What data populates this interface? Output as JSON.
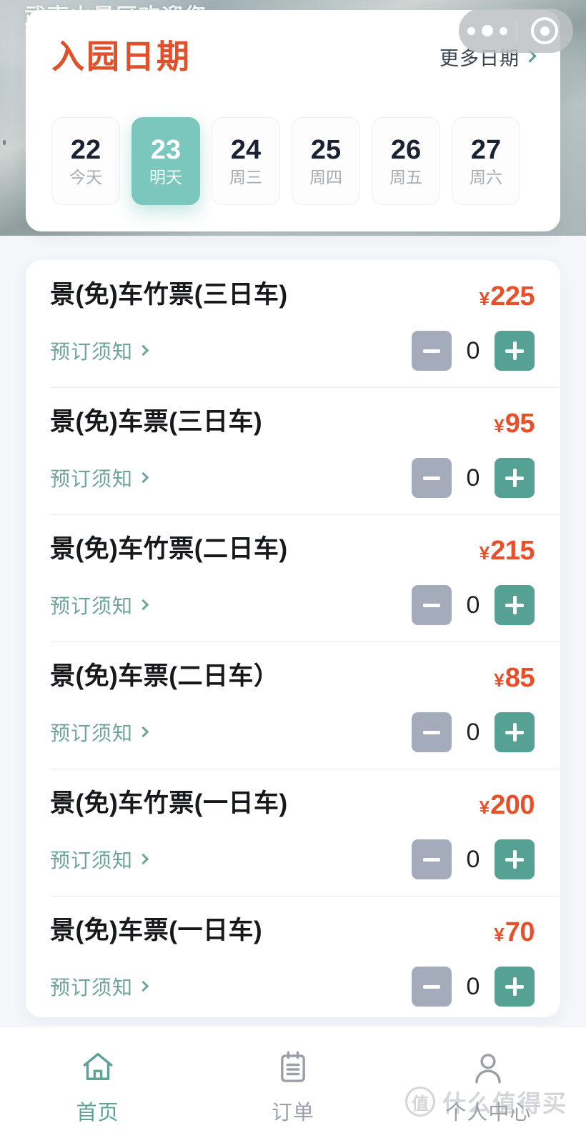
{
  "hero": {
    "caption": "武夷山景区欢迎您"
  },
  "capsule": {
    "menu_icon": "more-dots-icon",
    "target_icon": "target-circle-icon"
  },
  "date_section": {
    "title": "入园日期",
    "more_label": "更多日期",
    "more_chevron_icon": "chevron-right-icon",
    "days": [
      {
        "num": "22",
        "label": "今天",
        "selected": false
      },
      {
        "num": "23",
        "label": "明天",
        "selected": true
      },
      {
        "num": "24",
        "label": "周三",
        "selected": false
      },
      {
        "num": "25",
        "label": "周四",
        "selected": false
      },
      {
        "num": "26",
        "label": "周五",
        "selected": false
      },
      {
        "num": "27",
        "label": "周六",
        "selected": false
      }
    ]
  },
  "tickets": {
    "notice_label": "预订须知",
    "notice_chevron_icon": "chevron-right-icon",
    "currency": "¥",
    "minus_icon": "minus-icon",
    "plus_icon": "plus-icon",
    "items": [
      {
        "name": "景(免)车竹票(三日车)",
        "price": "225",
        "qty": "0"
      },
      {
        "name": "景(免)车票(三日车)",
        "price": "95",
        "qty": "0"
      },
      {
        "name": "景(免)车竹票(二日车)",
        "price": "215",
        "qty": "0"
      },
      {
        "name": "景(免)车票(二日车）",
        "price": "85",
        "qty": "0"
      },
      {
        "name": "景(免)车竹票(一日车)",
        "price": "200",
        "qty": "0"
      },
      {
        "name": "景(免)车票(一日车)",
        "price": "70",
        "qty": "0"
      }
    ]
  },
  "tabbar": {
    "tabs": [
      {
        "label": "首页",
        "icon": "home-icon",
        "active": true
      },
      {
        "label": "订单",
        "icon": "clipboard-icon",
        "active": false
      },
      {
        "label": "个人中心",
        "icon": "person-icon",
        "active": false
      }
    ]
  },
  "watermark": {
    "badge": "值",
    "text": "什么值得买"
  },
  "colors": {
    "accent_teal": "#55a193",
    "selected_chip": "#7cc7bd",
    "price_red": "#e8502c",
    "title_red": "#e0502a",
    "muted_gray": "#a4abba",
    "page_bg": "#f4f6fa"
  }
}
